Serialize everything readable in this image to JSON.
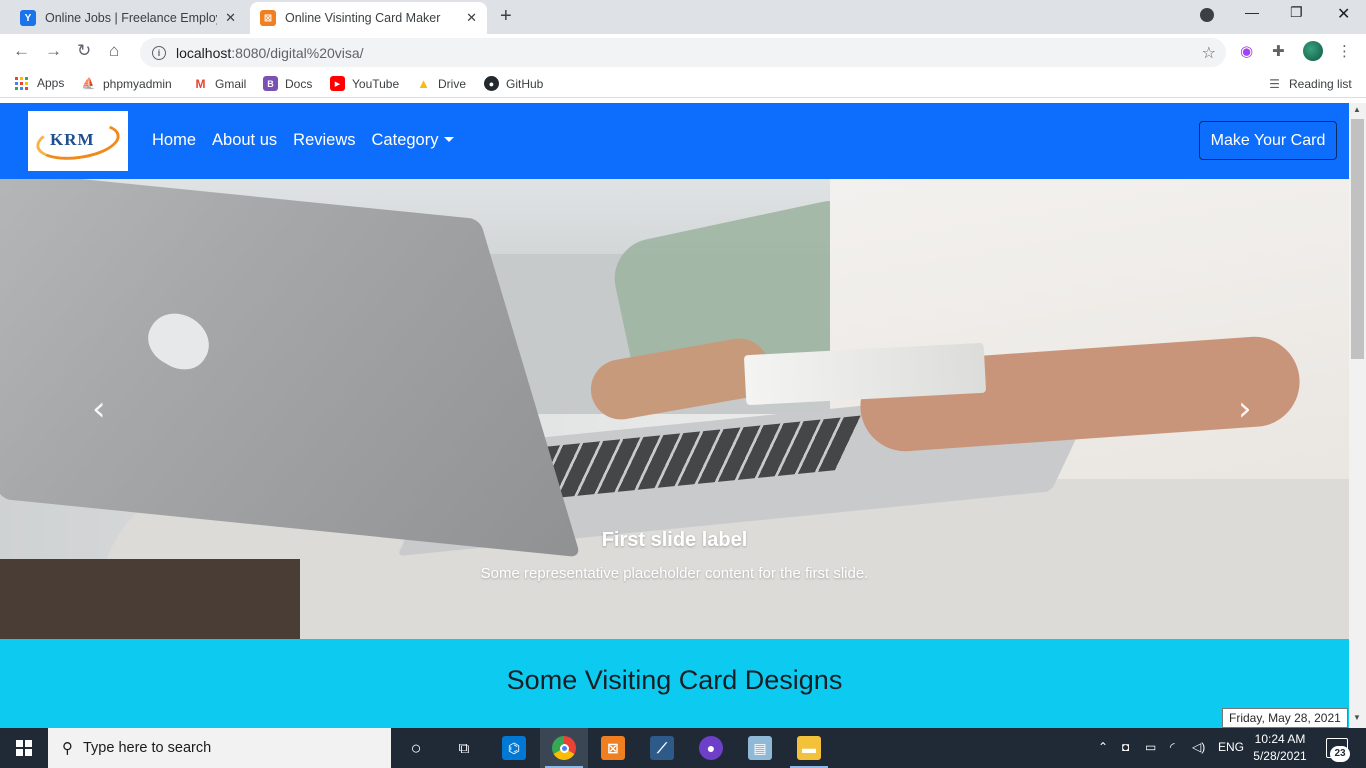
{
  "browser": {
    "tabs": [
      {
        "title": "Online Jobs | Freelance Employm",
        "active": false
      },
      {
        "title": "Online Visinting Card Maker",
        "active": true
      }
    ],
    "address": {
      "host": "localhost",
      "path": ":8080/digital%20visa/"
    },
    "bookmarks": [
      "Apps",
      "phpmyadmin",
      "Gmail",
      "Docs",
      "YouTube",
      "Drive",
      "GitHub"
    ],
    "reading_list": "Reading list"
  },
  "page": {
    "logo_text": "KRM",
    "nav": {
      "home": "Home",
      "about": "About us",
      "reviews": "Reviews",
      "category": "Category"
    },
    "cta": "Make Your Card",
    "carousel": {
      "caption_title": "First slide label",
      "caption_text": "Some representative placeholder content for the first slide.",
      "prev_icon": "chevron-left-icon",
      "next_icon": "chevron-right-icon"
    },
    "section_heading": "Some Visiting Card Designs"
  },
  "tooltip": "Friday, May 28, 2021",
  "taskbar": {
    "search_placeholder": "Type here to search",
    "language": "ENG",
    "time": "10:24 AM",
    "date": "5/28/2021",
    "notifications": "23"
  },
  "colors": {
    "navbar": "#0d6efd",
    "designs_section": "#0dcaf0",
    "taskbar": "#1f2a36"
  }
}
